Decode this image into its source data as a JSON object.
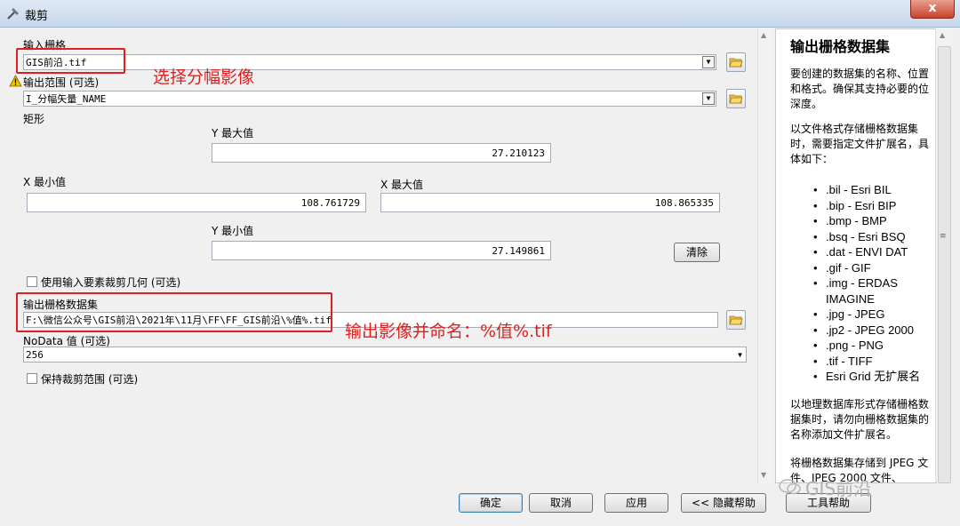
{
  "window": {
    "title": "裁剪",
    "close_label": "x"
  },
  "form": {
    "input_raster": {
      "label": "输入栅格",
      "value": "GIS前沿.tif"
    },
    "output_extent": {
      "label": "输出范围 (可选)",
      "value": "I_分幅矢量_NAME"
    },
    "rectangle": {
      "label": "矩形",
      "y_max_label": "Y 最大值",
      "y_max": "27.210123",
      "x_min_label": "X 最小值",
      "x_min": "108.761729",
      "x_max_label": "X 最大值",
      "x_max": "108.865335",
      "y_min_label": "Y 最小值",
      "y_min": "27.149861",
      "clear_label": "清除"
    },
    "use_geometry": {
      "label": "使用输入要素裁剪几何 (可选)",
      "checked": false
    },
    "output_raster": {
      "label": "输出栅格数据集",
      "value": "F:\\微信公众号\\GIS前沿\\2021年\\11月\\FF\\FF_GIS前沿\\%值%.tif"
    },
    "nodata": {
      "label": "NoData 值 (可选)",
      "value": "256"
    },
    "keep_extent": {
      "label": "保持裁剪范围 (可选)",
      "checked": false
    }
  },
  "annotations": {
    "select_image": "选择分幅影像",
    "output_name": "输出影像并命名：%值%.tif"
  },
  "help": {
    "title": "输出栅格数据集",
    "p1": "要创建的数据集的名称、位置和格式。确保其支持必要的位深度。",
    "p2": "以文件格式存储栅格数据集时，需要指定文件扩展名，具体如下：",
    "formats": [
      ".bil - Esri BIL",
      ".bip - Esri BIP",
      ".bmp - BMP",
      ".bsq - Esri BSQ",
      ".dat - ENVI DAT",
      ".gif - GIF",
      ".img - ERDAS IMAGINE",
      ".jpg - JPEG",
      ".jp2 - JPEG 2000",
      ".png - PNG",
      ".tif - TIFF",
      "Esri Grid 无扩展名"
    ],
    "p3": "以地理数据库形式存储栅格数据集时，请勿向栅格数据集的名称添加文件扩展名。",
    "p4": "将栅格数据集存储到 JPEG 文件、JPEG 2000 文件、"
  },
  "buttons": {
    "ok": "确定",
    "cancel": "取消",
    "apply": "应用",
    "hide_help": "<< 隐藏帮助",
    "tool_help": "工具帮助"
  },
  "watermark": "GIS前沿",
  "colors": {
    "annotation": "#e02020",
    "close": "#c7432b"
  }
}
